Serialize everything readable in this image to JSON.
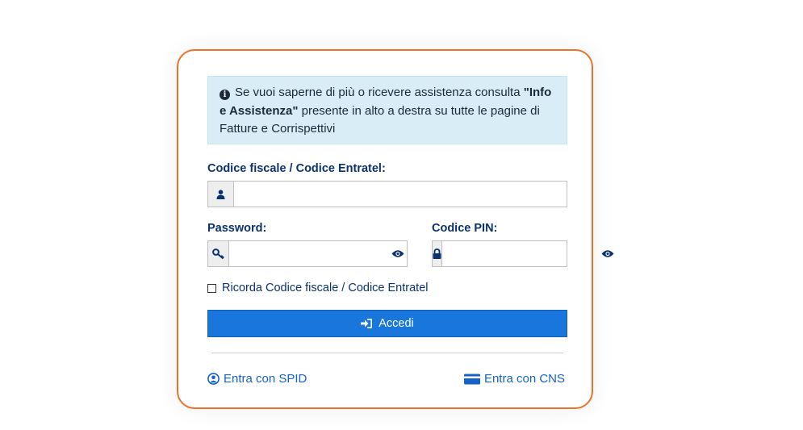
{
  "info": {
    "text_before": "Se vuoi saperne di più o ricevere assistenza consulta ",
    "bold": "\"Info e Assistenza\"",
    "text_after": " presente in alto a destra su tutte le pagine di Fatture e Corrispettivi",
    "icon": "info-circle-icon"
  },
  "form": {
    "codice_label": "Codice fiscale / Codice Entratel:",
    "codice_value": "",
    "password_label": "Password:",
    "password_value": "",
    "pin_label": "Codice PIN:",
    "pin_value": "",
    "remember_label": "Ricorda Codice fiscale / Codice Entratel",
    "remember_checked": false,
    "submit_label": "Accedi"
  },
  "links": {
    "spid_label": "Entra con SPID",
    "cns_label": "Entra con CNS"
  },
  "colors": {
    "card_border": "#e8732a",
    "primary": "#1876dc",
    "label": "#0b3270",
    "link": "#1462c8",
    "info_bg": "#d9edf7"
  }
}
